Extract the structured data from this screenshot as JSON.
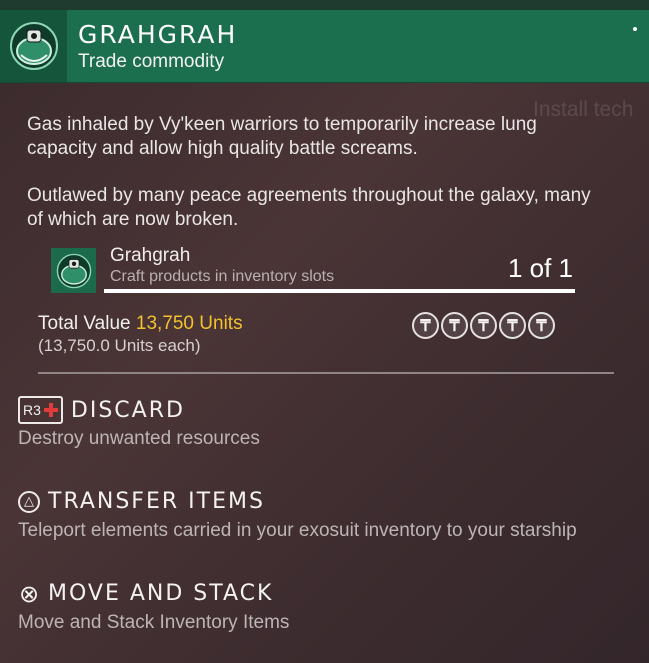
{
  "header": {
    "title": "GRAHGRAH",
    "subtitle": "Trade commodity",
    "icon": "grahgrah-canister-icon"
  },
  "background_ghost_text": "Install tech",
  "description": [
    "Gas inhaled by Vy'keen warriors to temporarily increase lung capacity and allow high quality battle screams.",
    "Outlawed by many peace agreements throughout the galaxy, many of which are now broken."
  ],
  "item": {
    "name": "Grahgrah",
    "subtitle": "Craft products in inventory slots",
    "count": "1 of 1",
    "icon": "grahgrah-canister-icon"
  },
  "value": {
    "total_label": "Total Value",
    "total_amount": "13,750 Units",
    "each": "(13,750.0 Units each)",
    "rating_icons": [
      "units-icon",
      "units-icon",
      "units-icon",
      "units-icon",
      "units-icon"
    ],
    "coin_glyph": "₸"
  },
  "actions": [
    {
      "button": "R3",
      "icon": "r3-discard-icon",
      "title": "DISCARD",
      "description": "Destroy unwanted resources"
    },
    {
      "button": "△",
      "icon": "triangle-button-icon",
      "title": "TRANSFER ITEMS",
      "description": "Teleport elements carried in your exosuit inventory to your starship"
    },
    {
      "button": "⊗",
      "icon": "cross-button-icon",
      "title": "MOVE AND STACK",
      "description": "Move and Stack Inventory Items"
    }
  ],
  "colors": {
    "header_bg": "#1b6e4e",
    "panel_bg": "#3f2e31",
    "gold": "#f2c230",
    "discard_red": "#e23b3b"
  }
}
